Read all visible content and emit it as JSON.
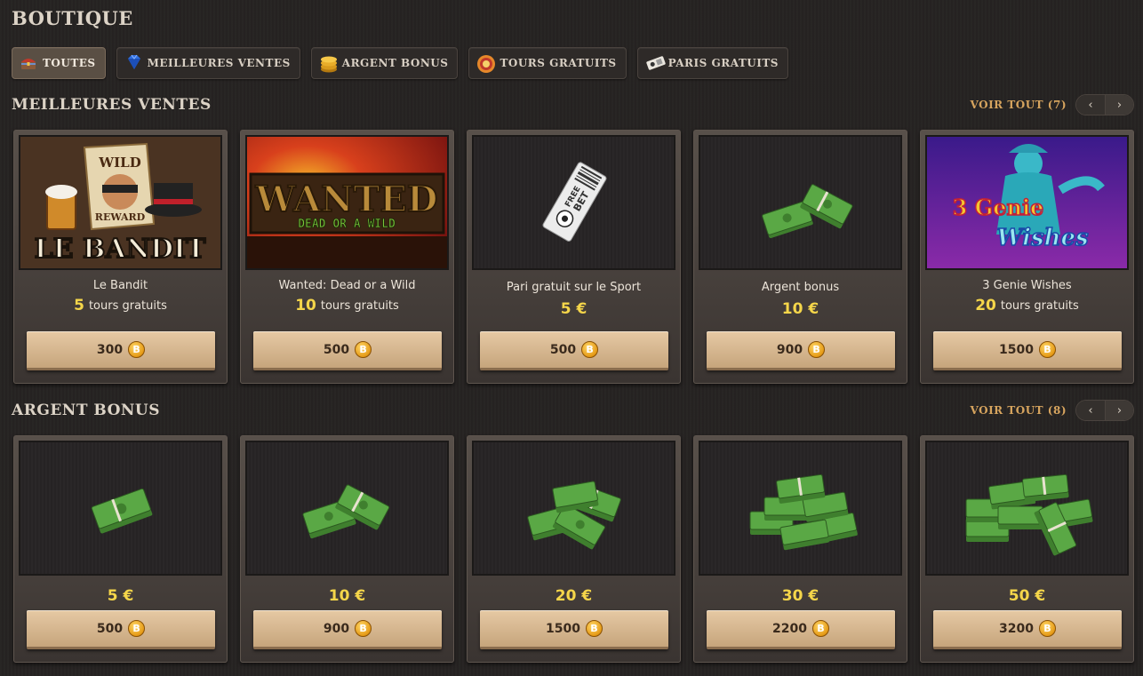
{
  "page": {
    "title": "BOUTIQUE"
  },
  "filters": [
    {
      "label": "TOUTES",
      "icon": "treasure-chest-icon",
      "active": true
    },
    {
      "label": "MEILLEURES VENTES",
      "icon": "diamond-icon",
      "active": false
    },
    {
      "label": "ARGENT BONUS",
      "icon": "coin-stack-icon",
      "active": false
    },
    {
      "label": "TOURS GRATUITS",
      "icon": "spin-icon",
      "active": false
    },
    {
      "label": "PARIS GRATUITS",
      "icon": "ticket-icon",
      "active": false
    }
  ],
  "bestsellers": {
    "title": "MEILLEURES VENTES",
    "see_all": "VOIR TOUT (7)",
    "prev": "‹",
    "next": "›",
    "items": [
      {
        "name": "Le Bandit",
        "amount": "5",
        "unit": "tours gratuits",
        "price": "300",
        "art": "le-bandit"
      },
      {
        "name": "Wanted: Dead or a Wild",
        "amount": "10",
        "unit": "tours gratuits",
        "price": "500",
        "art": "wanted"
      },
      {
        "name": "Pari gratuit sur le Sport",
        "amount": "5 €",
        "unit": "",
        "price": "500",
        "art": "free-bet"
      },
      {
        "name": "Argent bonus",
        "amount": "10 €",
        "unit": "",
        "price": "900",
        "art": "cash-2"
      },
      {
        "name": "3 Genie Wishes",
        "amount": "20",
        "unit": "tours gratuits",
        "price": "1500",
        "art": "genie"
      }
    ]
  },
  "bonus": {
    "title": "ARGENT BONUS",
    "see_all": "VOIR TOUT (8)",
    "prev": "‹",
    "next": "›",
    "items": [
      {
        "amount": "5 €",
        "price": "500",
        "art": "cash-1"
      },
      {
        "amount": "10 €",
        "price": "900",
        "art": "cash-2"
      },
      {
        "amount": "20 €",
        "price": "1500",
        "art": "cash-3"
      },
      {
        "amount": "30 €",
        "price": "2200",
        "art": "cash-4"
      },
      {
        "amount": "50 €",
        "price": "3200",
        "art": "cash-5"
      }
    ]
  },
  "art_text": {
    "bandit_wild": "WILD",
    "bandit_reward": "REWARD",
    "bandit_logo": "LE BANDIT",
    "wanted_title": "WANTED",
    "wanted_sub": "DEAD OR A WILD",
    "free_bet_1": "FREE",
    "free_bet_2": "BET",
    "genie_1": "3 Genie",
    "genie_2": "Wishes"
  },
  "currency_glyph": "B",
  "colors": {
    "accent": "#d6a45e",
    "amount": "#f5d64a",
    "button": "#d9b993",
    "cash": "#4f9a3c"
  }
}
